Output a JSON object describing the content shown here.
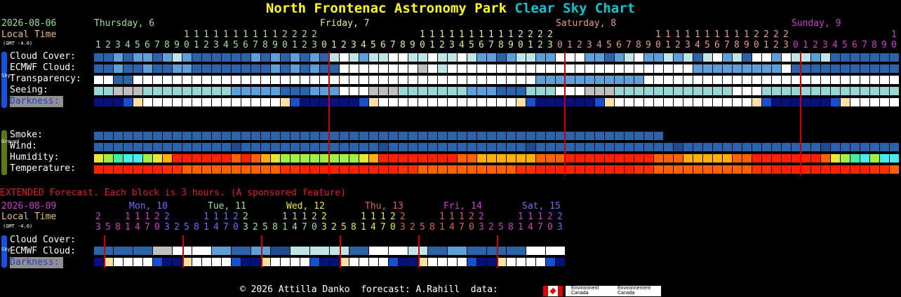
{
  "title": {
    "part1": "North Frontenac Astronomy Park",
    "part2": "Clear Sky Chart",
    "color1": "#ffff00",
    "color2": "#00c8d6"
  },
  "header": {
    "date": "2026-08-06",
    "local_time": "Local Time",
    "gmt": "(GMT -4.0)",
    "days": [
      {
        "label": "Thursday, 6",
        "color": "#9be29b"
      },
      {
        "label": "Friday, 7",
        "color": "#e8e88a"
      },
      {
        "label": "Saturday, 8",
        "color": "#e89a8a"
      },
      {
        "label": "Sunday, 9",
        "color": "#d03ad0"
      }
    ],
    "hours": {
      "start": 1,
      "count": 138
    }
  },
  "sky_rows": [
    {
      "label": "Cloud Cover:",
      "key": "cloud"
    },
    {
      "label": "ECMWF Cloud:",
      "key": "ecmwf"
    },
    {
      "label": "Transparency:",
      "key": "trans"
    },
    {
      "label": "Seeing:",
      "key": "seeing"
    },
    {
      "label": "Darkness:",
      "key": "dark"
    }
  ],
  "ground_rows": [
    {
      "label": "Smoke:",
      "key": "smoke"
    },
    {
      "label": "Wind:",
      "key": "wind"
    },
    {
      "label": "Humidity:",
      "key": "humid"
    },
    {
      "label": "Temperature:",
      "key": "temp"
    }
  ],
  "side_labels": {
    "sky": "Sky",
    "ground": "Ground"
  },
  "extended": {
    "note": "EXTENDED Forecast. Each block is 3 hours. (A sponsored feature)",
    "date": "2026-08-09",
    "local_time": "Local Time",
    "gmt": "(GMT -4.0)",
    "days": [
      {
        "label": "Mon, 10",
        "color": "#6a6aff"
      },
      {
        "label": "Tue, 11",
        "color": "#9be29b"
      },
      {
        "label": "Wed, 12",
        "color": "#e8e830"
      },
      {
        "label": "Thu, 13",
        "color": "#e06050"
      },
      {
        "label": "Fri, 14",
        "color": "#d03ad0"
      },
      {
        "label": "Sat, 15",
        "color": "#6a6aff"
      }
    ],
    "hour_digits_top": "2.........................................",
    "rows": [
      {
        "label": "Cloud Cover:"
      },
      {
        "label": "ECMWF Cloud:"
      },
      {
        "label": "Darkness:"
      }
    ]
  },
  "footer": {
    "copyright": "© 2026 Attilla Danko",
    "forecast": "forecast: A.Rahill",
    "data": "data:",
    "env1": "Environment",
    "env1b": "Canada",
    "env2": "Environnement",
    "env2b": "Canada"
  },
  "palette": {
    "white": "#ffffff",
    "cloud_light": "#bfe6e6",
    "cloud_mid": "#5d9fd8",
    "cloud_dark": "#2c62a8",
    "cloud_darkest": "#0d3f7e",
    "grey": "#c0c0c0"
  }
}
